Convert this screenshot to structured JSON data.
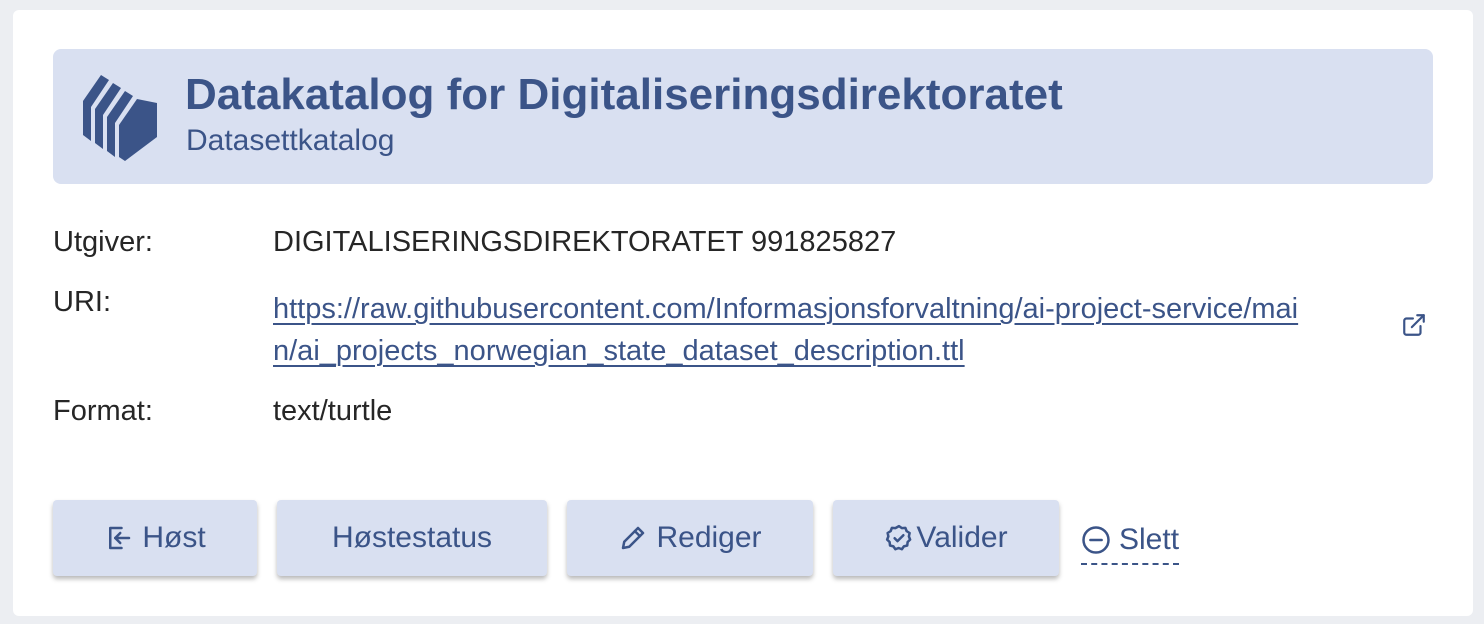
{
  "catalog": {
    "title": "Datakatalog for Digitaliseringsdirektoratet",
    "subtitle": "Datasettkatalog",
    "logo_icon": "catalog-stack-icon"
  },
  "fields": {
    "publisher_label": "Utgiver:",
    "publisher_value": "DIGITALISERINGSDIREKTORATET 991825827",
    "uri_label": "URI:",
    "uri_value": "https://raw.githubusercontent.com/Informasjonsforvaltning/ai-project-service/main/ai_projects_norwegian_state_dataset_description.ttl",
    "format_label": "Format:",
    "format_value": "text/turtle"
  },
  "actions": {
    "harvest_label": "Høst",
    "harvest_status_label": "Høstestatus",
    "edit_label": "Rediger",
    "validate_label": "Valider",
    "delete_label": "Slett"
  },
  "colors": {
    "accent": "#3b5488",
    "header_bg": "#d9e0f1",
    "text": "#262626",
    "page_bg": "#eceef2"
  }
}
